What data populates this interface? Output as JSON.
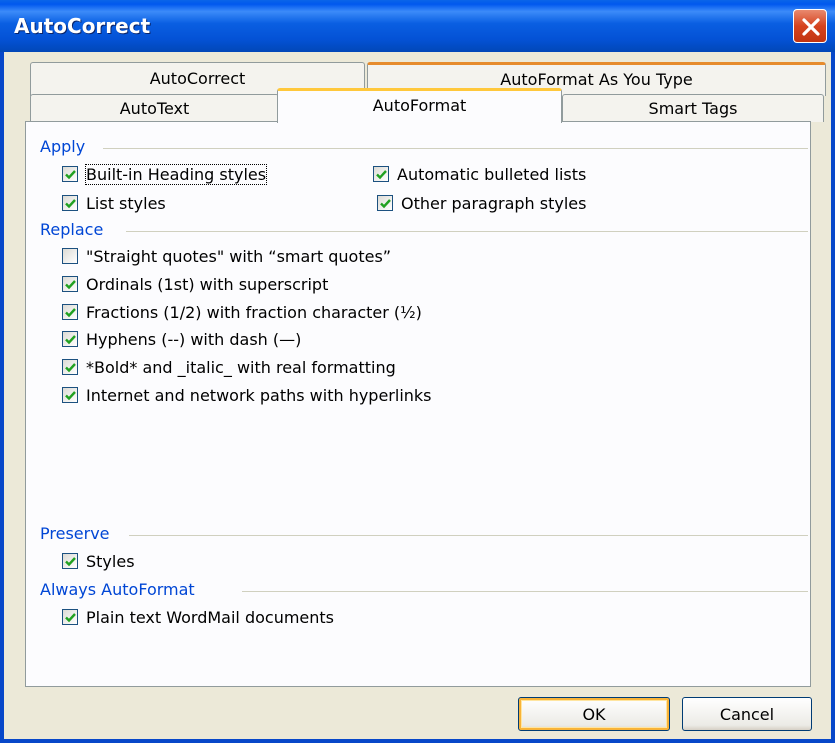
{
  "window": {
    "title": "AutoCorrect"
  },
  "tabs_back": [
    {
      "label": "AutoCorrect"
    },
    {
      "label": "AutoFormat As You Type"
    }
  ],
  "tabs_front": [
    {
      "label": "AutoText"
    },
    {
      "label": "AutoFormat",
      "active": true
    },
    {
      "label": "Smart Tags"
    }
  ],
  "groups": {
    "apply": "Apply",
    "replace": "Replace",
    "preserve": "Preserve",
    "always": "Always AutoFormat"
  },
  "apply_options": [
    {
      "label": "Built-in Heading styles",
      "checked": true
    },
    {
      "label": "Automatic bulleted lists",
      "checked": true
    },
    {
      "label": "List styles",
      "checked": true
    },
    {
      "label": "Other paragraph styles",
      "checked": true
    }
  ],
  "replace_options": [
    {
      "label": "\"Straight quotes\" with “smart quotes”",
      "checked": false
    },
    {
      "label": "Ordinals (1st) with superscript",
      "checked": true
    },
    {
      "label": "Fractions (1/2) with fraction character (½)",
      "checked": true
    },
    {
      "label": "Hyphens (--) with dash (—)",
      "checked": true
    },
    {
      "label": "*Bold* and _italic_ with real formatting",
      "checked": true
    },
    {
      "label": "Internet and network paths with hyperlinks",
      "checked": true
    }
  ],
  "preserve_options": [
    {
      "label": "Styles",
      "checked": true
    }
  ],
  "always_options": [
    {
      "label": "Plain text WordMail documents",
      "checked": true
    }
  ],
  "buttons": {
    "ok": "OK",
    "cancel": "Cancel"
  },
  "colors": {
    "title_bar": "#0054E3",
    "group_label": "#0046D5",
    "dialog_bg": "#ECE9D8",
    "checkmark": "#21A121",
    "close": "#D5431F"
  }
}
